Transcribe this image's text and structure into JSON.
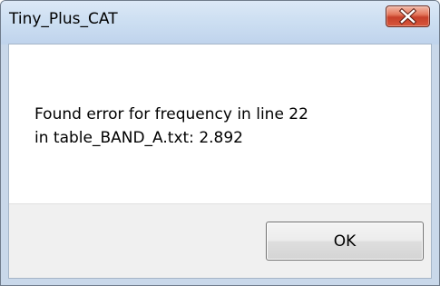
{
  "window": {
    "title": "Tiny_Plus_CAT"
  },
  "message": {
    "line1": "Found error for frequency in line 22",
    "line2": "in table_BAND_A.txt: 2.892"
  },
  "buttons": {
    "ok_label": "OK",
    "close_icon": "close-x-icon"
  },
  "colors": {
    "close_button": "#c7402a",
    "titlebar": "#cddff2",
    "button_area": "#f0f0f0"
  }
}
